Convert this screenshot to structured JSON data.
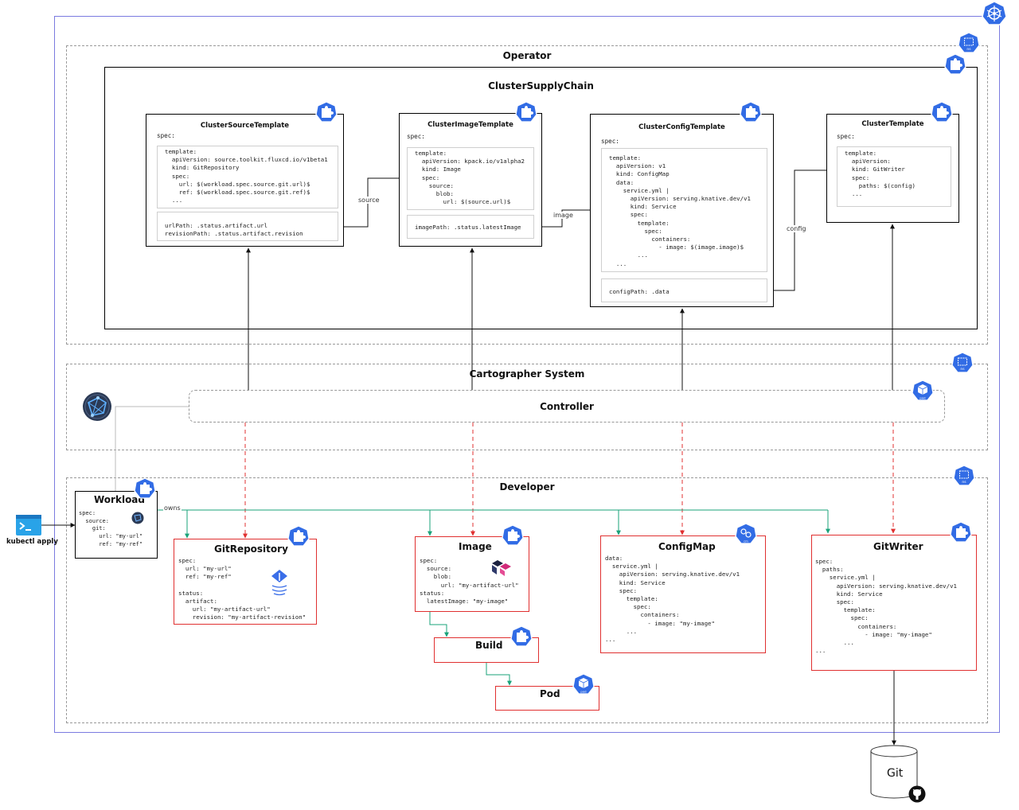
{
  "groups": {
    "operator": "Operator",
    "supply_chain": "ClusterSupplyChain",
    "cartographer": "Cartographer System",
    "controller": "Controller",
    "developer": "Developer"
  },
  "templates": {
    "source": {
      "title": "ClusterSourceTemplate",
      "spec": "spec:",
      "template": "template:\n  apiVersion: source.toolkit.fluxcd.io/v1beta1\n  kind: GitRepository\n  spec:\n    url: $(workload.spec.source.git.url)$\n    ref: $(workload.spec.source.git.ref)$\n  ...",
      "paths": "urlPath: .status.artifact.url\nrevisionPath: .status.artifact.revision"
    },
    "image": {
      "title": "ClusterImageTemplate",
      "spec": "spec:",
      "template": "template:\n  apiVersion: kpack.io/v1alpha2\n  kind: Image\n  spec:\n    source:\n      blob:\n        url: $(source.url)$",
      "paths": "imagePath: .status.latestImage"
    },
    "config": {
      "title": "ClusterConfigTemplate",
      "spec": "spec:",
      "template": "template:\n  apiVersion: v1\n  kind: ConfigMap\n  data:\n    service.yml |\n      apiVersion: serving.knative.dev/v1\n      kind: Service\n      spec:\n        template:\n          spec:\n            containers:\n              - image: $(image.image)$\n        ...\n  ...",
      "paths": "configPath: .data"
    },
    "cluster": {
      "title": "ClusterTemplate",
      "spec": "spec:",
      "template": "template:\n  apiVersion:\n  kind: GitWriter\n  spec:\n    paths: $(config)\n  ..."
    }
  },
  "edge_labels": {
    "source": "source",
    "image": "image",
    "config": "config",
    "owns": "owns"
  },
  "resources": {
    "workload": {
      "title": "Workload",
      "body": "spec:\n  source:\n    git:\n      url: \"my-url\"\n      ref: \"my-ref\""
    },
    "gitrepository": {
      "title": "GitRepository",
      "body": "spec:\n  url: \"my-url\"\n  ref: \"my-ref\"\n\nstatus:\n  artifact:\n    url: \"my-artifact-url\"\n    revision: \"my-artifact-revision\""
    },
    "image": {
      "title": "Image",
      "body": "spec:\n  source:\n    blob:\n      url: \"my-artifact-url\"\nstatus:\n  latestImage: \"my-image\""
    },
    "configmap": {
      "title": "ConfigMap",
      "body": "data:\n  service.yml |\n    apiVersion: serving.knative.dev/v1\n    kind: Service\n    spec:\n      template:\n        spec:\n          containers:\n            - image: \"my-image\"\n      ...\n..."
    },
    "gitwriter": {
      "title": "GitWriter",
      "body": "spec:\n  paths:\n    service.yml |\n      apiVersion: serving.knative.dev/v1\n      kind: Service\n      spec:\n        template:\n          spec:\n            containers:\n              - image: \"my-image\"\n        ...\n..."
    },
    "build": {
      "title": "Build"
    },
    "pod": {
      "title": "Pod"
    }
  },
  "kubectl_label": "kubectl apply",
  "git_label": "Git",
  "icon_tags": {
    "crd": "cr",
    "ns": "ns",
    "pod": "pod",
    "cm": "cm"
  },
  "colors": {
    "k8s_blue": "#326ce5",
    "cluster_border": "#7b7be0",
    "resource_red": "#e03030",
    "owns_green": "#1aa37a",
    "dispatch_red": "#e03030"
  }
}
